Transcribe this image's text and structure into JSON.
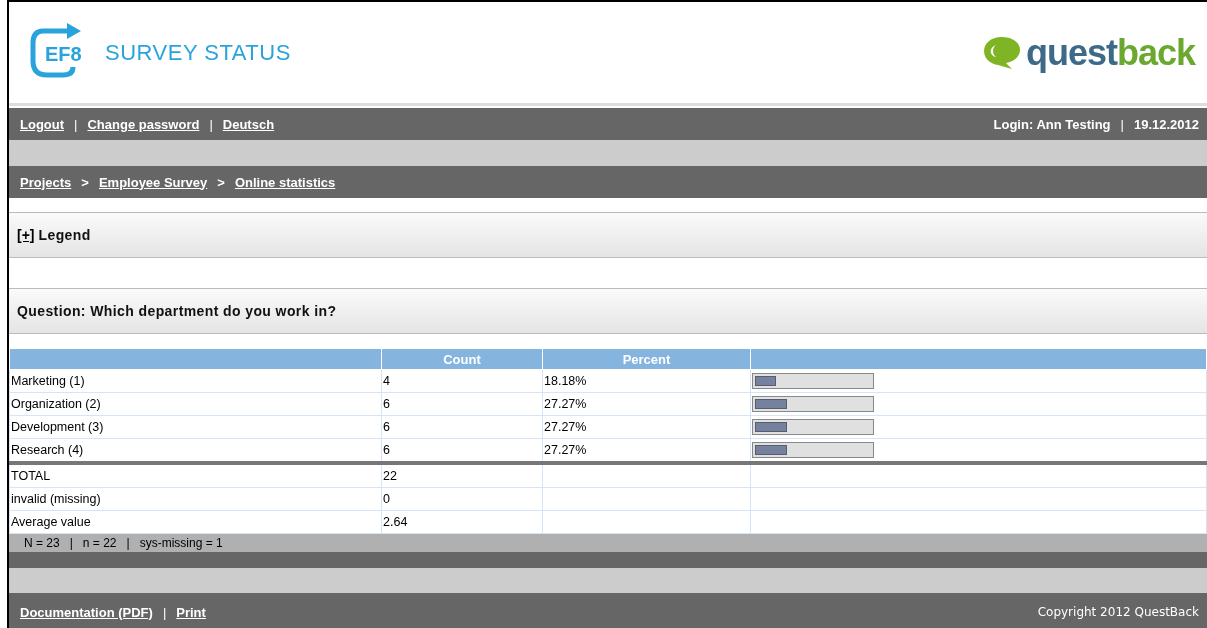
{
  "header": {
    "logo": {
      "mark": "EF8",
      "text": "SURVEY STATUS"
    },
    "brand": {
      "part1": "quest",
      "part2": "back"
    }
  },
  "nav": {
    "links": [
      "Logout",
      "Change password",
      "Deutsch"
    ],
    "separator": "|",
    "login": "Login: Ann Testing",
    "date": "19.12.2012"
  },
  "breadcrumb": {
    "items": [
      "Projects",
      "Employee Survey",
      "Online statistics"
    ],
    "separator": ">"
  },
  "legend": {
    "toggle": "[+]",
    "title": "Legend"
  },
  "question": {
    "title": "Question: Which department do you work in?"
  },
  "table": {
    "columns": [
      "Count",
      "Percent"
    ],
    "rows": [
      {
        "label": "Marketing (1)",
        "count": "4",
        "percent": "18.18%",
        "level": 0.1818
      },
      {
        "label": "Organization (2)",
        "count": "6",
        "percent": "27.27%",
        "level": 0.2727
      },
      {
        "label": "Development (3)",
        "count": "6",
        "percent": "27.27%",
        "level": 0.2727
      },
      {
        "label": "Research (4)",
        "count": "6",
        "percent": "27.27%",
        "level": 0.2727
      }
    ],
    "summary": [
      {
        "label": "TOTAL",
        "value": "22"
      },
      {
        "label": "invalid (missing)",
        "value": "0"
      },
      {
        "label": "Average value",
        "value": "2.64"
      }
    ],
    "stats": [
      "N = 23",
      "n = 22",
      "sys-missing = 1"
    ],
    "stats_separator": "|"
  },
  "footer": {
    "links": [
      "Documentation (PDF)",
      "Print"
    ],
    "separator": "|",
    "copyright": "Copyright 2012 QuestBack"
  }
}
